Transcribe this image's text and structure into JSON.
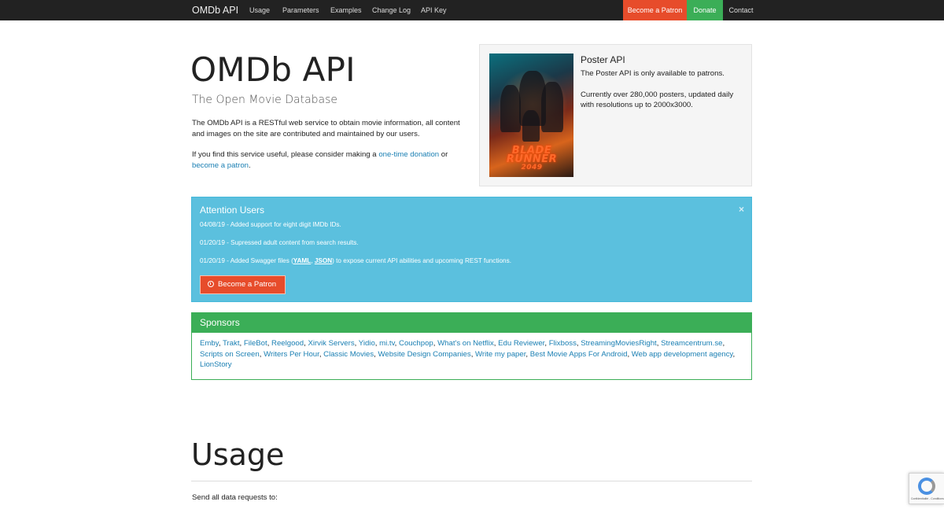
{
  "nav": {
    "brand": "OMDb API",
    "links": [
      "Usage",
      "Parameters",
      "Examples",
      "Change Log",
      "API Key"
    ],
    "patron": "Become a Patron",
    "donate": "Donate",
    "contact": "Contact"
  },
  "hero": {
    "title": "OMDb API",
    "subtitle": "The Open Movie Database",
    "p1": "The OMDb API is a RESTful web service to obtain movie information, all content and images on the site are contributed and maintained by our users.",
    "p2_before": "If you find this service useful, please consider making a ",
    "p2_link1": "one-time donation",
    "p2_mid": " or ",
    "p2_link2": "become a patron",
    "p2_after": "."
  },
  "poster": {
    "title": "Poster API",
    "text1": "The Poster API is only available to patrons.",
    "text2": "Currently over 280,000 posters, updated daily with resolutions up to 2000x3000.",
    "logo_line1": "BLADE",
    "logo_line2": "RUNNER",
    "logo_line3": "2049"
  },
  "alert": {
    "title": "Attention Users",
    "close": "×",
    "line1": "04/08/19 - Added support for eight digit IMDb IDs.",
    "line2": "01/20/19 - Supressed adult content from search results.",
    "line3_before": "01/20/19 - Added Swagger files (",
    "line3_yaml": "YAML",
    "line3_sep": ", ",
    "line3_json": "JSON",
    "line3_after": ") to expose current API abilities and upcoming REST functions.",
    "button": "Become a Patron"
  },
  "sponsors": {
    "title": "Sponsors",
    "items": [
      "Emby",
      "Trakt",
      "FileBot",
      "Reelgood",
      "Xirvik Servers",
      "Yidio",
      "mi.tv",
      "Couchpop",
      "What's on Netflix",
      "Edu Reviewer",
      "Flixboss",
      "StreamingMoviesRight",
      "Streamcentrum.se",
      "Scripts on Screen",
      "Writers Per Hour",
      "Classic Movies",
      "Website Design Companies",
      "Write my paper",
      "Best Movie Apps For Android",
      "Web app development agency",
      "LionStory"
    ]
  },
  "usage": {
    "title": "Usage",
    "text": "Send all data requests to:"
  },
  "recaptcha": {
    "text": "Confidentialité - Conditions"
  },
  "colors": {
    "navbar": "#222222",
    "patron": "#e74c2b",
    "donate": "#3bae57",
    "alert": "#5bc0de",
    "link": "#1a7fb3"
  }
}
